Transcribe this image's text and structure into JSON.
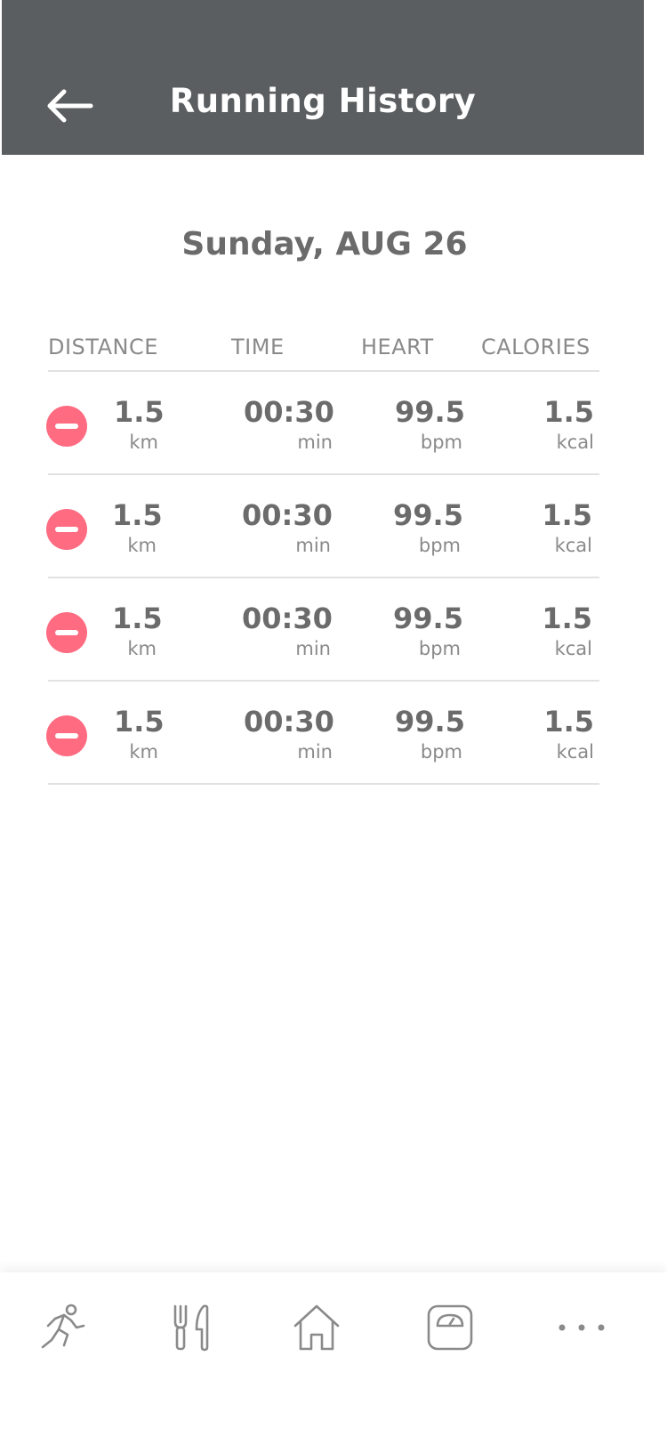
{
  "header": {
    "title": "Running History"
  },
  "date": "Sunday, AUG 26",
  "columns": [
    "DISTANCE",
    "TIME",
    "HEART",
    "CALORIES"
  ],
  "rows": [
    {
      "distance": "1.5",
      "distance_unit": "km",
      "time": "00:30",
      "time_unit": "min",
      "heart": "99.5",
      "heart_unit": "bpm",
      "calories": "1.5",
      "calories_unit": "kcal"
    },
    {
      "distance": "1.5",
      "distance_unit": "km",
      "time": "00:30",
      "time_unit": "min",
      "heart": "99.5",
      "heart_unit": "bpm",
      "calories": "1.5",
      "calories_unit": "kcal"
    },
    {
      "distance": "1.5",
      "distance_unit": "km",
      "time": "00:30",
      "time_unit": "min",
      "heart": "99.5",
      "heart_unit": "bpm",
      "calories": "1.5",
      "calories_unit": "kcal"
    },
    {
      "distance": "1.5",
      "distance_unit": "km",
      "time": "00:30",
      "time_unit": "min",
      "heart": "99.5",
      "heart_unit": "bpm",
      "calories": "1.5",
      "calories_unit": "kcal"
    }
  ],
  "colors": {
    "header_bg": "#5b5e60",
    "delete": "#ff6b81",
    "text": "#6b6b6b"
  },
  "nav": [
    "running-icon",
    "fork-knife-icon",
    "home-icon",
    "scale-icon",
    "more-icon"
  ]
}
